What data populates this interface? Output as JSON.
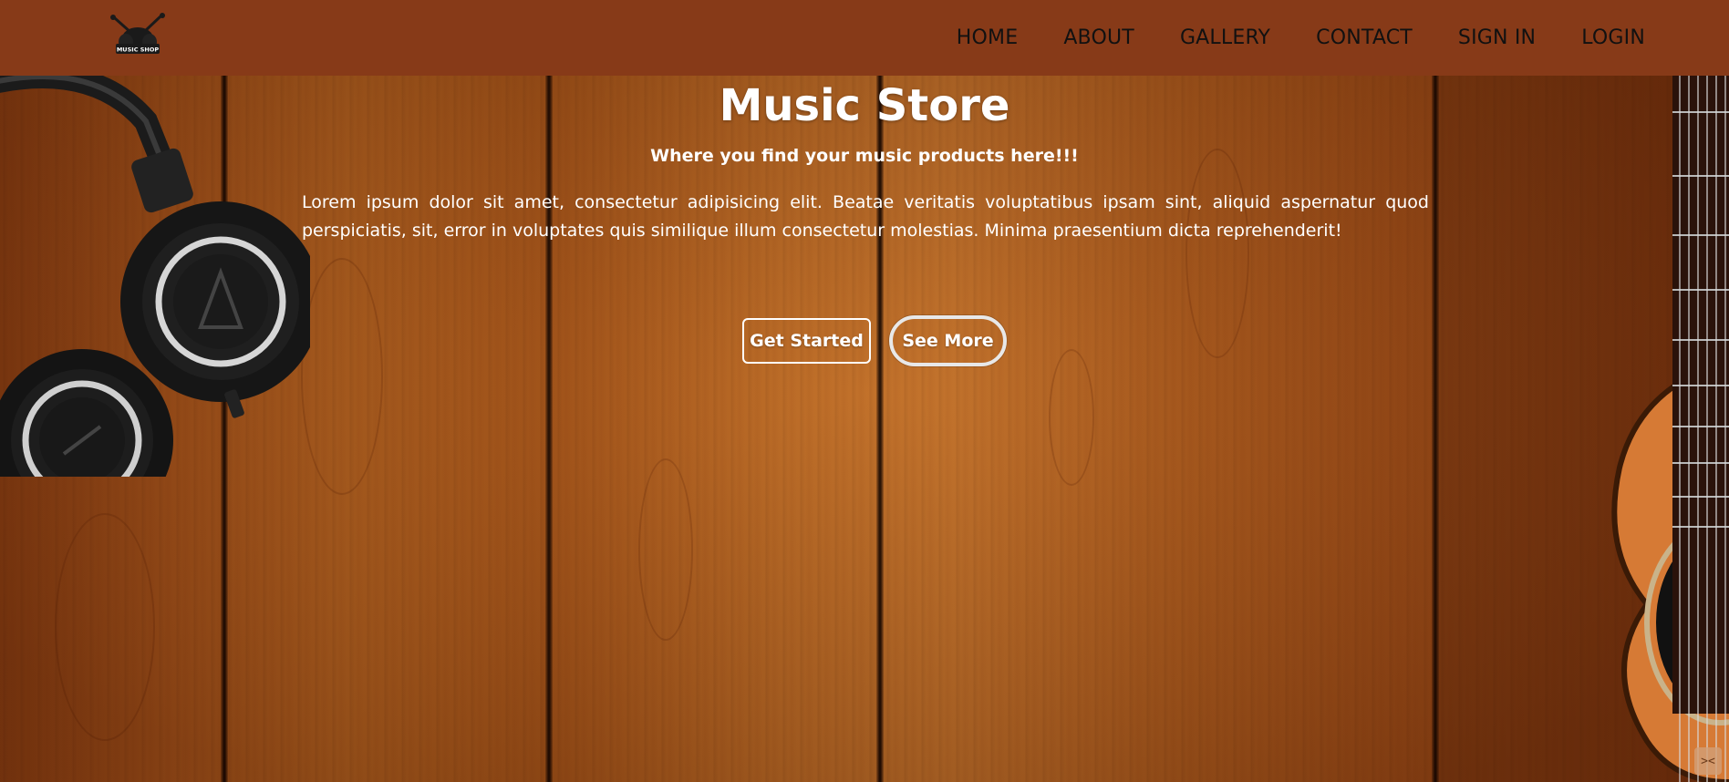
{
  "brand": {
    "logo_text": "MUSIC SHOP"
  },
  "nav": {
    "items": [
      "HOME",
      "ABOUT",
      "GALLERY",
      "CONTACT",
      "SIGN IN",
      "LOGIN"
    ]
  },
  "hero": {
    "title": "Music Store",
    "subtitle": "Where you find your music products here!!!",
    "text": "Lorem ipsum dolor sit amet, consectetur adipisicing elit. Beatae veritatis voluptatibus ipsam sint, aliquid aspernatur quod perspiciatis, sit, error in voluptates quis similique illum consectetur molestias. Minima praesentium dicta reprehenderit!",
    "buttons": {
      "primary": "Get Started",
      "secondary": "See More"
    }
  },
  "corner_widget": {
    "icon": "collapse-arrows-icon",
    "glyph": "><"
  },
  "colors": {
    "navbar": "#873a18",
    "wood": "#b1601f",
    "text": "#ffffff",
    "nav_text": "#111111"
  }
}
